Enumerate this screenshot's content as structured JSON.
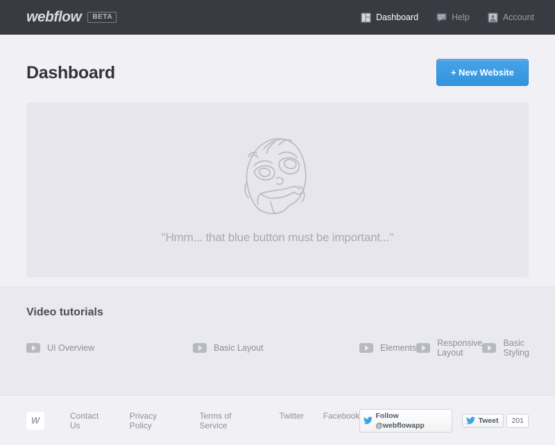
{
  "brand": {
    "word": "webflow",
    "badge": "BETA"
  },
  "topnav": {
    "items": [
      {
        "label": "Dashboard",
        "icon": "dashboard-layout-icon",
        "active": true
      },
      {
        "label": "Help",
        "icon": "speech-bubble-icon",
        "active": false
      },
      {
        "label": "Account",
        "icon": "user-portrait-icon",
        "active": false
      }
    ]
  },
  "page": {
    "title": "Dashboard",
    "new_website_label": "+ New Website"
  },
  "hero": {
    "illustration": "hmm-rage-face-illustration",
    "caption": "\"Hmm... that blue button must be important...\""
  },
  "tutorials": {
    "heading": "Video tutorials",
    "items": [
      {
        "label": "UI Overview",
        "icon": "play-icon"
      },
      {
        "label": "Basic Layout",
        "icon": "play-icon"
      },
      {
        "label": "Elements",
        "icon": "play-icon"
      },
      {
        "label": "Responsive Layout",
        "icon": "play-icon"
      },
      {
        "label": "Basic Styling",
        "icon": "play-icon"
      }
    ]
  },
  "footer": {
    "logo_letter": "W",
    "links": [
      {
        "label": "Contact Us"
      },
      {
        "label": "Privacy Policy"
      },
      {
        "label": "Terms of Service"
      },
      {
        "label": "Twitter"
      },
      {
        "label": "Facebook"
      }
    ],
    "follow_label": "Follow @webflowapp",
    "tweet_label": "Tweet",
    "tweet_count": "201"
  },
  "colors": {
    "topbar": "#383b42",
    "accent_blue": "#3094dd",
    "page_bg": "#f0f0f5",
    "hero_bg": "#e6e6ec",
    "tutorials_bg": "#e9e9ef",
    "muted_text": "#8d909a"
  }
}
